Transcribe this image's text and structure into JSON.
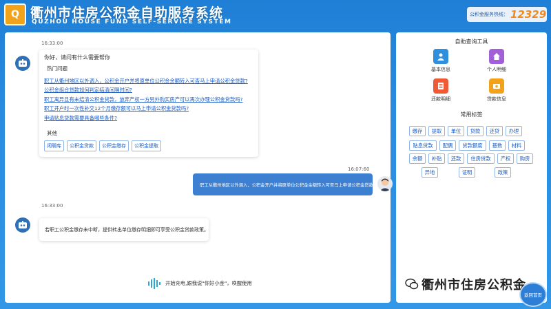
{
  "header": {
    "title_cn": "衢州市住房公积金自助服务系统",
    "title_en": "QUZHOU HOUSE FUND SELF-SERVICE SYSTEM",
    "hotline_label": "公积金服务热线：",
    "hotline_number": "12329",
    "logo_text": "Q"
  },
  "chat": {
    "messages": [
      {
        "time": "16:33:00",
        "greeting": "你好，请问有什么需要帮你",
        "hot_title": "热门问题",
        "questions": [
          "职工从衢州地区以外调入，公积金开户并将原单位公积金余额转入可否马上申请公积金贷款?",
          "公积金组合贷款如何判定结清间隔时间?",
          "职工离异且有未结清公积金贷款，放弃产权一方另外购买房产可以再次办理公积金贷款吗?",
          "职工开户时一次性补交12个月缴存额可以马上申请公积金贷款吗?",
          "申请贴息贷款需要具备哪些条件?"
        ],
        "other_title": "其他",
        "other_tags": [
          "闲聊库",
          "公积金贷款",
          "公积金缴存",
          "公积金提取"
        ]
      },
      {
        "time": "16:07:60",
        "text": "职工从衢州地区以外调入，公积金开户并将原单位公积金余额转入可否马上申请公积金贷款?"
      },
      {
        "time": "16:33:00",
        "text": "若职工公积金缴存未中断，提供转出单位缴存明细即可享受公积金贷款政策。"
      }
    ],
    "voice_prompt": "开始充电,跟我说\"你好小金\"，唤醒使用"
  },
  "tools": {
    "title": "自助查询工具",
    "items": [
      {
        "label": "基本信息",
        "color": "#2f8fdc",
        "icon": "person-icon"
      },
      {
        "label": "个人明细",
        "color": "#a260d8",
        "icon": "house-icon"
      },
      {
        "label": "还款明细",
        "color": "#ef5b36",
        "icon": "list-icon"
      },
      {
        "label": "贷款信息",
        "color": "#f3a21b",
        "icon": "money-icon"
      }
    ]
  },
  "common_tags": {
    "title": "常用标签",
    "rows": [
      [
        "缴存",
        "提取",
        "单位",
        "贷款",
        "还贷",
        "办理"
      ],
      [
        "贴息贷款",
        "配偶",
        "贷款额度",
        "基数",
        "材料"
      ],
      [
        "余额",
        "补贴",
        "还款",
        "住房贷款",
        "产权",
        "购房"
      ],
      [
        "异地",
        "证明",
        "政策"
      ]
    ]
  },
  "watermark": {
    "text": "衢州市住房公积金"
  },
  "home_button": {
    "label": "返回首页"
  },
  "colors": {
    "accent": "#1a5cc4",
    "header_bg": "#1f7fd6",
    "hotline": "#f08a1c",
    "user_bubble": "#3d7fd0"
  }
}
